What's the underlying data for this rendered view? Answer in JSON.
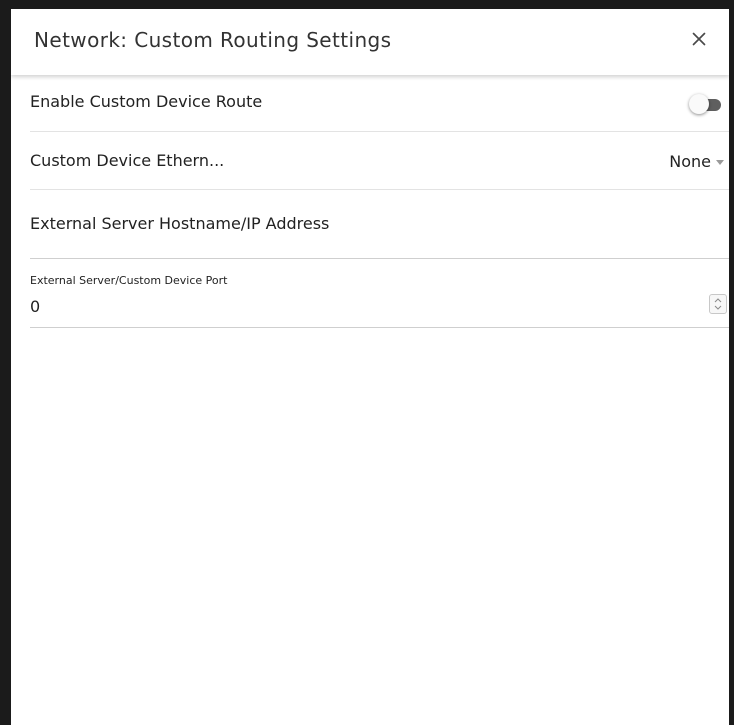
{
  "dialog": {
    "title": "Network: Custom Routing Settings",
    "close_icon": "close-icon"
  },
  "settings": {
    "enable_route": {
      "label": "Enable Custom Device Route",
      "enabled": false
    },
    "ethernet": {
      "label": "Custom Device Ethern...",
      "selected": "None",
      "options": [
        "None"
      ]
    },
    "hostname": {
      "label": "External Server Hostname/IP Address"
    },
    "port": {
      "label": "External Server/Custom Device Port",
      "value": "0"
    }
  }
}
